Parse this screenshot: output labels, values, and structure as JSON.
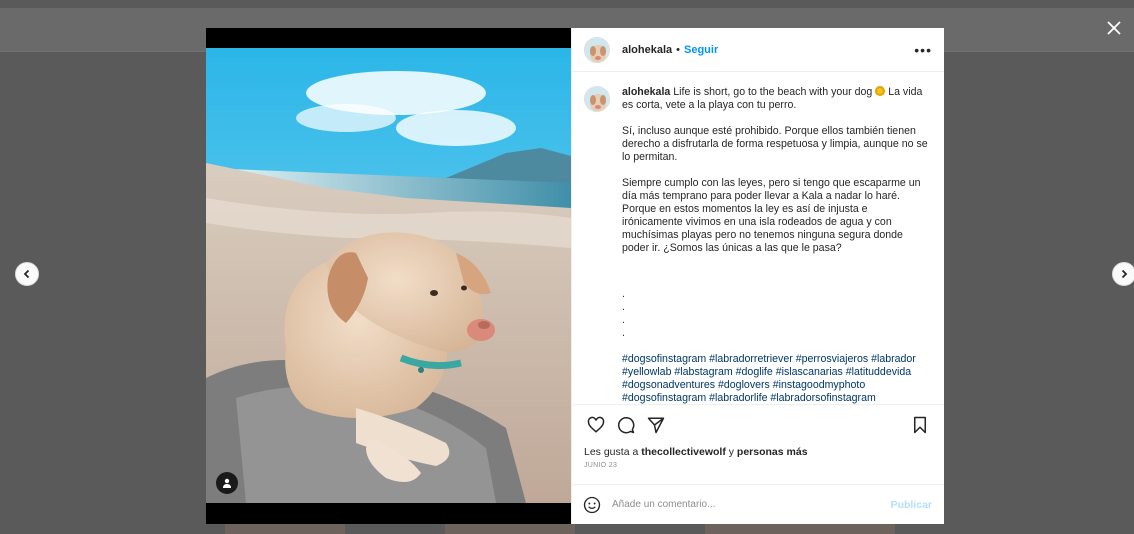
{
  "post": {
    "username": "alohekala",
    "separator": "•",
    "follow_label": "Seguir",
    "more_label": "•••",
    "caption_user": "alohekala",
    "caption_intro_before_icon": "Life is short, go to the beach with your dog",
    "caption_intro_after_icon": "La vida es corta, vete a la playa con tu perro.",
    "paragraph_2": "Sí, incluso aunque esté prohibido. Porque ellos también tienen derecho a disfrutarla de forma respetuosa y limpia, aunque no se lo permitan.",
    "paragraph_3": "Siempre cumplo con las leyes, pero si tengo que escaparme un día más temprano para poder llevar a Kala a nadar lo haré. Porque en estos momentos la ley es así de injusta e irónicamente vivimos en una isla rodeados de agua y con muchísimas playas pero no tenemos ninguna segura donde poder ir. ¿Somos las únicas a las que le pasa?",
    "dots": [
      ".",
      ".",
      ".",
      "."
    ],
    "hashtags": "#dogsofinstagram #labradorretriever #perrosviajeros #labrador #yellowlab #labstagram #doglife #islascanarias #latituddevida #dogsonadventures #doglovers #instagoodmyphoto #dogsofinstagram #labradorlife #labradorsofinstagram",
    "likes_prefix": "Les gusta a",
    "likes_user": "thecollectivewolf",
    "likes_connector": "y",
    "likes_others": "personas más",
    "date": "JUNIO 23"
  },
  "comment": {
    "placeholder": "Añade un comentario...",
    "publish_label": "Publicar"
  },
  "icons": {
    "close": "close-icon",
    "prev": "chevron-left-icon",
    "next": "chevron-right-icon",
    "like": "heart-icon",
    "comment": "comment-icon",
    "share": "paper-plane-icon",
    "save": "bookmark-icon",
    "emoji": "smiley-icon",
    "tag": "user-tag-icon"
  },
  "colors": {
    "link_blue": "#0095f6",
    "publish_disabled": "#b2dffc",
    "hashtag": "#00376b"
  }
}
